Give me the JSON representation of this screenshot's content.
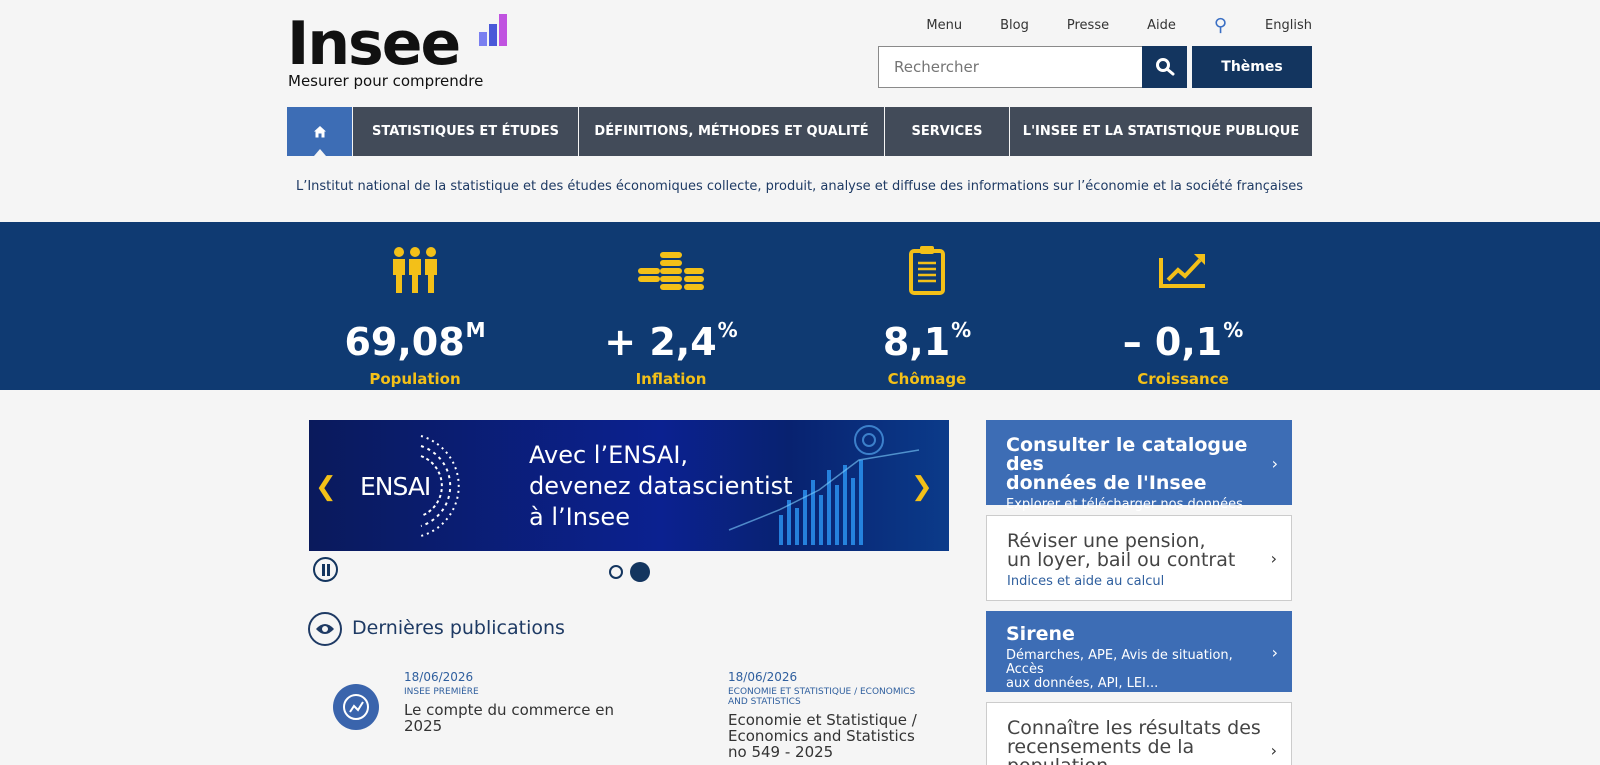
{
  "header": {
    "logo_word": "Insee",
    "logo_tagline": "Mesurer pour comprendre",
    "top_links": [
      "Menu",
      "Blog",
      "Presse",
      "Aide",
      "English"
    ],
    "search_placeholder": "Rechercher",
    "themes_label": "Thèmes"
  },
  "nav": {
    "items": [
      "STATISTIQUES ET ÉTUDES",
      "DÉFINITIONS, MÉTHODES ET QUALITÉ",
      "SERVICES",
      "L'INSEE ET LA STATISTIQUE PUBLIQUE"
    ]
  },
  "tagline": "L’Institut national de la statistique et des études économiques collecte, produit, analyse et diffuse des informations sur l’économie et la société françaises",
  "stats": [
    {
      "value": "69,08",
      "unit": "M",
      "label": "Population",
      "icon": "people-icon"
    },
    {
      "value": "+ 2,4",
      "unit": "%",
      "label": "Inflation",
      "icon": "coins-icon"
    },
    {
      "value": "8,1",
      "unit": "%",
      "label": "Chômage",
      "icon": "clipboard-icon"
    },
    {
      "value": "– 0,1",
      "unit": "%",
      "label": "Croissance",
      "icon": "growth-chart-icon"
    }
  ],
  "carousel": {
    "brand": "ENSAI",
    "line1": "Avec l’ENSAI,",
    "line2": "devenez datascientist",
    "line3": "à l’Insee",
    "active_slide": 2,
    "slide_count": 2
  },
  "publications": {
    "title": "Dernières publications",
    "items": [
      {
        "date": "18/06/2026",
        "category": "INSEE PREMIÈRE",
        "title1": "Le compte du commerce en",
        "title2": "2025",
        "title3": ""
      },
      {
        "date": "18/06/2026",
        "category": "ECONOMIE ET STATISTIQUE / ECONOMICS",
        "category2": "AND STATISTICS",
        "title1": "Economie et Statistique /",
        "title2": "Economics and Statistics",
        "title3": "no 549 - 2025"
      }
    ]
  },
  "cards": [
    {
      "title1": "Consulter le catalogue des",
      "title2": "données de l'Insee",
      "sub1": "Explorer et télécharger nos données",
      "sub2": ""
    },
    {
      "title1": "Réviser une pension,",
      "title2": "un loyer, bail ou contrat",
      "sub1": "Indices et aide au calcul",
      "sub2": ""
    },
    {
      "title1": "Sirene",
      "title2": "",
      "sub1": "Démarches, APE, Avis de situation, Accès",
      "sub2": "aux données, API, LEI..."
    },
    {
      "title1": "Connaître les résultats des",
      "title2": "recensements de la",
      "sub1": "population",
      "sub2": ""
    }
  ],
  "colors": {
    "navy": "#13355f",
    "band": "#0f3a72",
    "accent": "#3d6db5",
    "gold": "#f3c018"
  }
}
